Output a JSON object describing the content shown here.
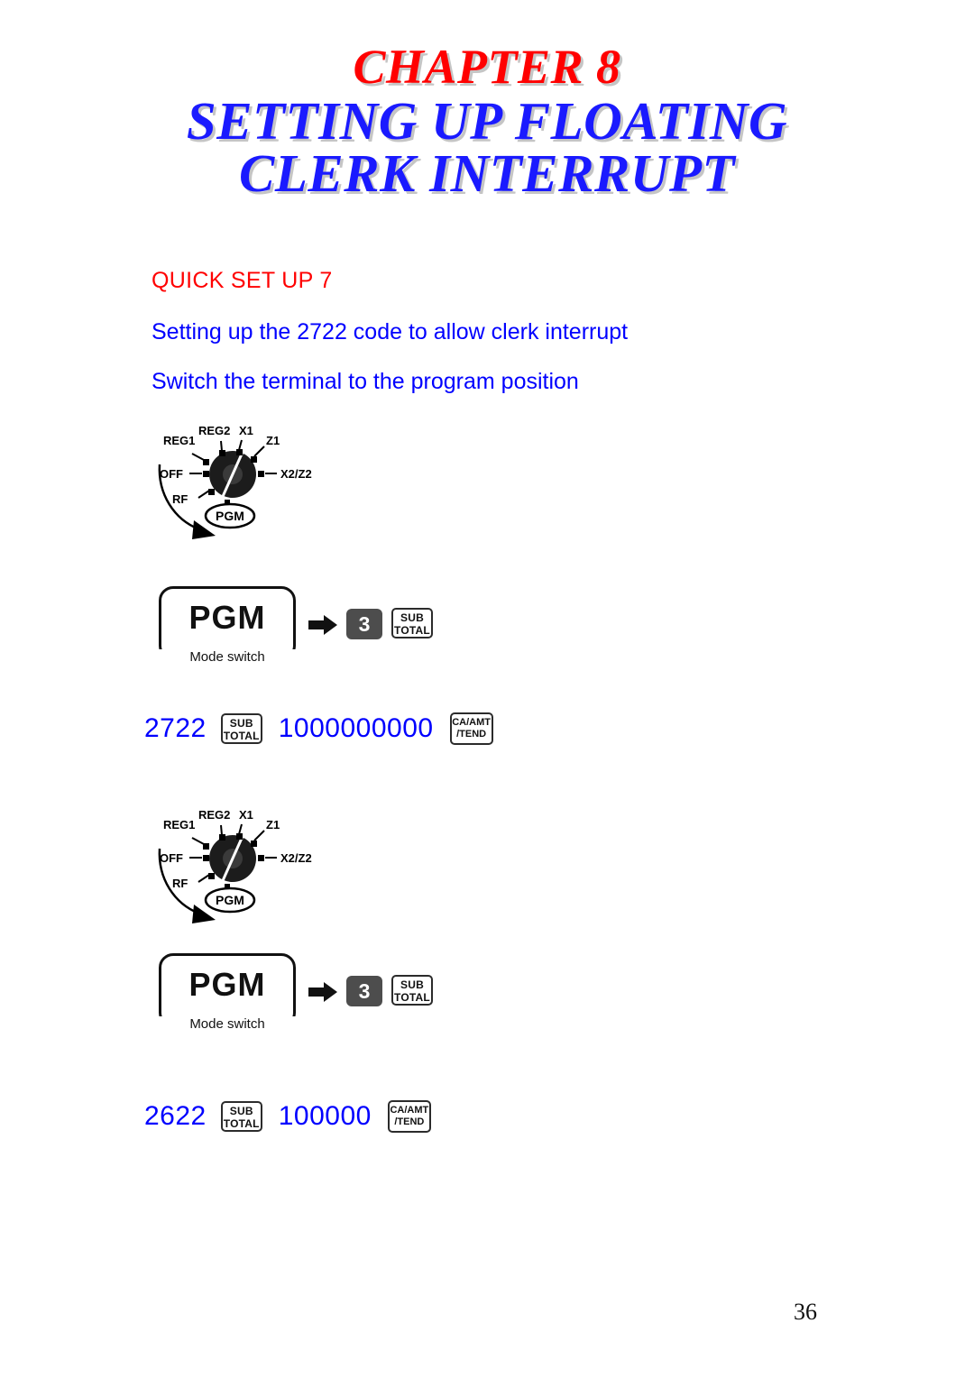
{
  "document": {
    "page_number": "36",
    "colors": {
      "title_red": "#ff0000",
      "title_blue": "#1a1aff",
      "text_blue": "#0000ff",
      "text_red": "#ff0000",
      "key_dark": "#4d4d4d"
    }
  },
  "title": {
    "chapter": "CHAPTER 8",
    "line1": "SETTING UP FLOATING",
    "line2": "CLERK INTERRUPT"
  },
  "headings": {
    "quick_setup": "QUICK SET UP 7",
    "subtitle": "Setting up the 2722 code to allow clerk interrupt",
    "instruction": "Switch the terminal to the program position"
  },
  "dial": {
    "labels": {
      "reg2": "REG2",
      "x1": "X1",
      "reg1": "REG1",
      "z1": "Z1",
      "off": "OFF",
      "x2z2": "X2/Z2",
      "rf": "RF",
      "pgm": "PGM"
    }
  },
  "mode_switch_figure": {
    "box_label": "PGM",
    "caption": "Mode switch",
    "key_3": "3",
    "key_subtotal_line1": "SUB",
    "key_subtotal_line2": "TOTAL"
  },
  "sequences": [
    {
      "code": "2722",
      "key_subtotal_line1": "SUB",
      "key_subtotal_line2": "TOTAL",
      "value": "1000000000",
      "key_tend_line1": "CA/AMT",
      "key_tend_line2": "/TEND"
    },
    {
      "code": "2622",
      "key_subtotal_line1": "SUB",
      "key_subtotal_line2": "TOTAL",
      "value": "100000",
      "key_tend_line1": "CA/AMT",
      "key_tend_line2": "/TEND"
    }
  ]
}
